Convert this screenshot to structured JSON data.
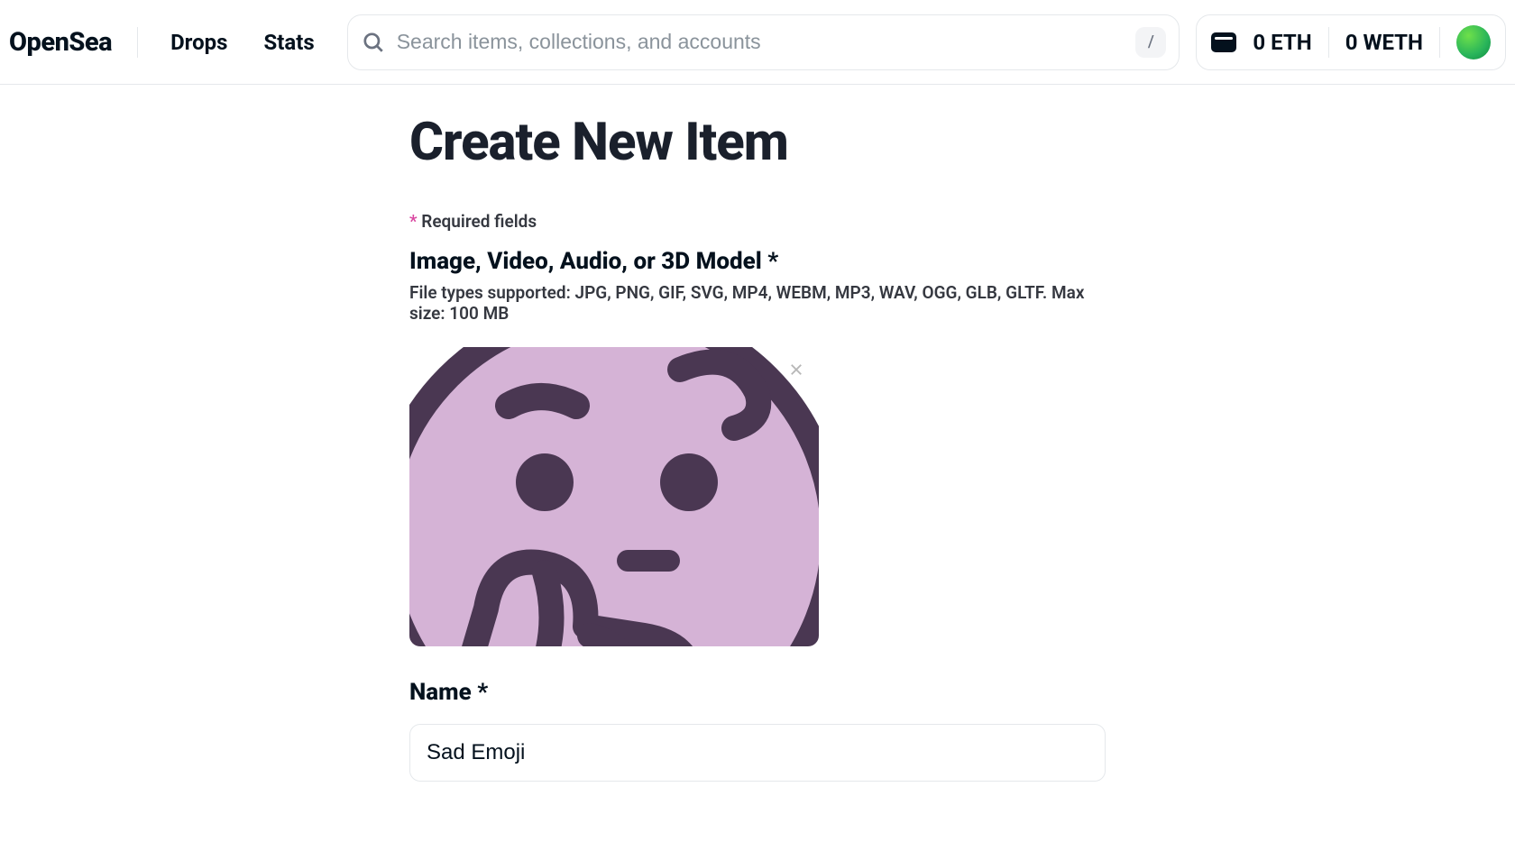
{
  "header": {
    "logo": "OpenSea",
    "nav": [
      "Drops",
      "Stats"
    ],
    "search_placeholder": "Search items, collections, and accounts",
    "slash_key": "/",
    "eth_balance": "0 ETH",
    "weth_balance": "0 WETH"
  },
  "page": {
    "title": "Create New Item",
    "required_star": "*",
    "required_text": " Required fields",
    "media_label": "Image, Video, Audio, or 3D Model *",
    "media_sub": "File types supported: JPG, PNG, GIF, SVG, MP4, WEBM, MP3, WAV, OGG, GLB, GLTF. Max size: 100 MB",
    "name_label": "Name *",
    "name_value": "Sad Emoji"
  }
}
